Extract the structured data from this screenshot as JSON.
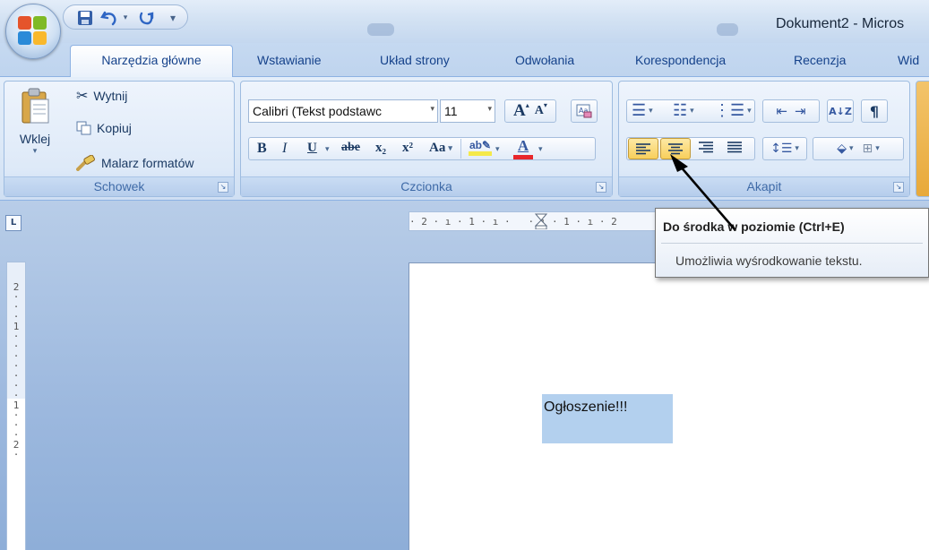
{
  "window": {
    "title": "Dokument2 - Micros"
  },
  "quick_access": {
    "save_icon": "save-icon",
    "undo_icon": "undo-icon",
    "redo_icon": "redo-icon",
    "customize": "▾"
  },
  "tabs": [
    {
      "label": "Narzędzia główne",
      "active": true
    },
    {
      "label": "Wstawianie"
    },
    {
      "label": "Układ strony"
    },
    {
      "label": "Odwołania"
    },
    {
      "label": "Korespondencja"
    },
    {
      "label": "Recenzja"
    },
    {
      "label": "Wid"
    }
  ],
  "clipboard": {
    "label": "Schowek",
    "paste": "Wklej",
    "cut": "Wytnij",
    "copy": "Kopiuj",
    "format_painter": "Malarz formatów"
  },
  "font": {
    "label": "Czcionka",
    "font_name": "Calibri (Tekst podstawc",
    "font_size": "11",
    "bold": "B",
    "italic": "I",
    "underline": "U",
    "strikethrough": "abe",
    "subscript": "x₂",
    "superscript": "x²",
    "change_case": "Aa",
    "grow": "A",
    "shrink": "A"
  },
  "paragraph": {
    "label": "Akapit",
    "active_alignment": "center"
  },
  "ruler": {
    "horizontal": "· 2 · ı · 1 · ı ·   · ı · 1 · ı · 2",
    "vertical": "2\n·\n·\n·\n1\n·\n·\n·\n·\n·\n·\n·\n1\n·\n·\n·\n2\n·",
    "corner": "L"
  },
  "document": {
    "text": "Ogłoszenie!!!"
  },
  "tooltip": {
    "title": "Do środka w poziomie (Ctrl+E)",
    "description": "Umożliwia wyśrodkowanie tekstu."
  },
  "colors": {
    "accent": "#15428b",
    "highlight": "#f8cf5b",
    "selection": "#b3d0ee",
    "font_color_bar": "#e8262b",
    "highlight_bar": "#f5e94a"
  }
}
